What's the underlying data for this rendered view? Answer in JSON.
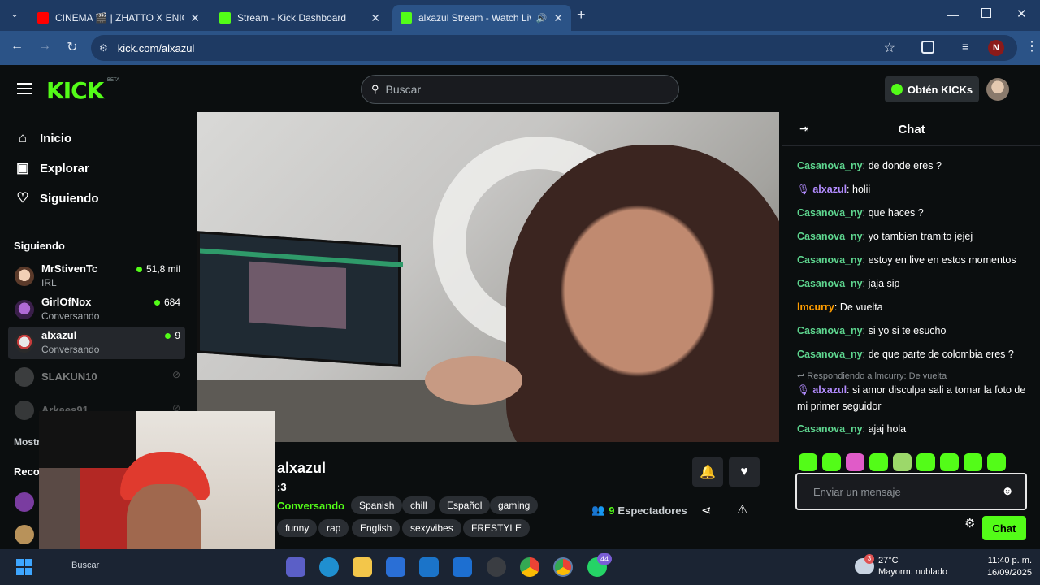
{
  "browser": {
    "tabs": [
      {
        "title": "CINEMA 🎬 | ZHATTO X ENIGMA",
        "close": "✕"
      },
      {
        "title": "Stream - Kick Dashboard",
        "close": "✕"
      },
      {
        "title": "alxazul Stream - Watch Live",
        "close": "✕"
      }
    ],
    "new_tab": "+",
    "url": "kick.com/alxazul",
    "profile_initial": "N"
  },
  "header": {
    "logo": "KICK",
    "beta": "BETA",
    "search_placeholder": "Buscar",
    "get_kicks": "Obtén KICKs"
  },
  "sidebar": {
    "nav": [
      {
        "label": "Inicio",
        "icon": "home-icon"
      },
      {
        "label": "Explorar",
        "icon": "compass-icon"
      },
      {
        "label": "Siguiendo",
        "icon": "heart-icon"
      }
    ],
    "following_heading": "Siguiendo",
    "following": [
      {
        "name": "MrStivenTc",
        "category": "IRL",
        "viewers": "51,8 mil"
      },
      {
        "name": "GirlOfNox",
        "category": "Conversando",
        "viewers": "684"
      },
      {
        "name": "alxazul",
        "category": "Conversando",
        "viewers": "9"
      },
      {
        "name": "SLAKUN10",
        "category": "",
        "viewers": ""
      },
      {
        "name": "Arkaes91",
        "category": "",
        "viewers": ""
      }
    ],
    "show_more_partial": "Mostr",
    "recommended_partial": "Reco"
  },
  "stream": {
    "streamer": "alxazul",
    "title": ":3",
    "category": "Conversando",
    "tags_row1": [
      "Spanish",
      "chill",
      "Español",
      "gaming"
    ],
    "tags_row2": [
      "funny",
      "rap",
      "English",
      "sexyvibes",
      "FRESTYLE"
    ],
    "viewers_count": "9",
    "viewers_label": "Espectadores"
  },
  "chat": {
    "title": "Chat",
    "messages": [
      {
        "user": "Casanova_ny",
        "text": "de donde eres ?",
        "color": "#5ed68f"
      },
      {
        "user": "alxazul",
        "text": "holii",
        "color": "#b38cff"
      },
      {
        "user": "Casanova_ny",
        "text": "que haces ?",
        "color": "#5ed68f"
      },
      {
        "user": "Casanova_ny",
        "text": "yo tambien tramito jejej",
        "color": "#5ed68f"
      },
      {
        "user": "Casanova_ny",
        "text": "estoy en live en estos momentos",
        "color": "#5ed68f"
      },
      {
        "user": "Casanova_ny",
        "text": "jaja sip",
        "color": "#5ed68f"
      },
      {
        "user": "lmcurry",
        "text": "De vuelta",
        "color": "#ff9d00"
      },
      {
        "user": "Casanova_ny",
        "text": "si yo si te esucho",
        "color": "#5ed68f"
      },
      {
        "user": "Casanova_ny",
        "text": "de que parte de colombia eres ?",
        "color": "#5ed68f"
      }
    ],
    "reply_context": "Respondiendo a lmcurry: De vuelta",
    "reply_message": {
      "user": "alxazul",
      "text": "si amor disculpa sali a tomar la foto de mi primer seguidor",
      "color": "#b38cff"
    },
    "last_message": {
      "user": "Casanova_ny",
      "text": "ajaj hola",
      "color": "#5ed68f"
    },
    "input_placeholder": "Enviar un mensaje",
    "send_button": "Chat"
  },
  "taskbar": {
    "search": "Buscar",
    "badge_whatsapp": "44",
    "weather_temp": "27°C",
    "weather_desc": "Mayorm. nublado",
    "weather_badge": "3",
    "time": "11:40 p. m.",
    "date": "16/09/2025"
  }
}
